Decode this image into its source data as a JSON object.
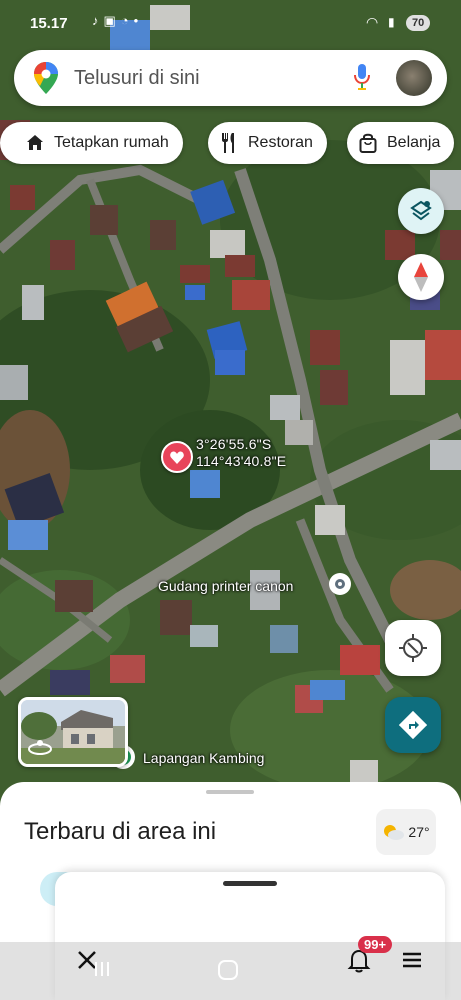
{
  "status_bar": {
    "time": "15.17",
    "icons": [
      "tiktok-icon",
      "image-icon",
      "messenger-icon",
      "dot"
    ],
    "battery": "70"
  },
  "search": {
    "placeholder": "Telusuri di sini"
  },
  "chips": [
    {
      "icon": "home-icon",
      "label": "Tetapkan rumah"
    },
    {
      "icon": "restaurant-icon",
      "label": "Restoran"
    },
    {
      "icon": "shopping-bag-icon",
      "label": "Belanja"
    }
  ],
  "map": {
    "dropped_pin": {
      "lat": "3°26'55.6\"S",
      "lng": "114°43'40.8\"E"
    },
    "places": [
      {
        "name": "Gudang printer canon"
      },
      {
        "name": "Lapangan Kambing"
      }
    ]
  },
  "sheet": {
    "title": "Terbaru di area ini",
    "weather_temp": "27°"
  },
  "overlay": {
    "notification_badge": "99+"
  },
  "colors": {
    "accent": "#1a73e8",
    "direction_fab": "#0e6e7e",
    "pin": "#e8445a",
    "badge": "#d9304a"
  }
}
